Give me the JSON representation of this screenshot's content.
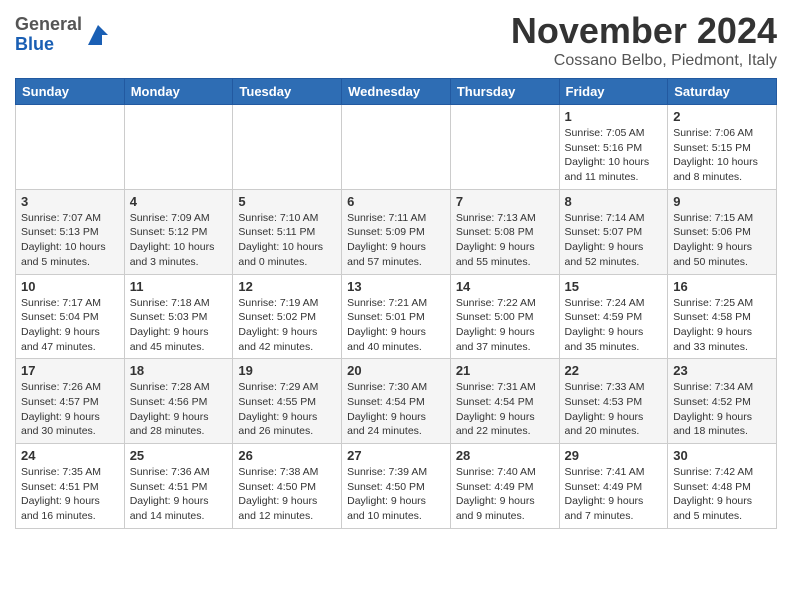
{
  "header": {
    "logo_general": "General",
    "logo_blue": "Blue",
    "month_title": "November 2024",
    "location": "Cossano Belbo, Piedmont, Italy"
  },
  "weekdays": [
    "Sunday",
    "Monday",
    "Tuesday",
    "Wednesday",
    "Thursday",
    "Friday",
    "Saturday"
  ],
  "weeks": [
    [
      {
        "day": "",
        "info": ""
      },
      {
        "day": "",
        "info": ""
      },
      {
        "day": "",
        "info": ""
      },
      {
        "day": "",
        "info": ""
      },
      {
        "day": "",
        "info": ""
      },
      {
        "day": "1",
        "info": "Sunrise: 7:05 AM\nSunset: 5:16 PM\nDaylight: 10 hours and 11 minutes."
      },
      {
        "day": "2",
        "info": "Sunrise: 7:06 AM\nSunset: 5:15 PM\nDaylight: 10 hours and 8 minutes."
      }
    ],
    [
      {
        "day": "3",
        "info": "Sunrise: 7:07 AM\nSunset: 5:13 PM\nDaylight: 10 hours and 5 minutes."
      },
      {
        "day": "4",
        "info": "Sunrise: 7:09 AM\nSunset: 5:12 PM\nDaylight: 10 hours and 3 minutes."
      },
      {
        "day": "5",
        "info": "Sunrise: 7:10 AM\nSunset: 5:11 PM\nDaylight: 10 hours and 0 minutes."
      },
      {
        "day": "6",
        "info": "Sunrise: 7:11 AM\nSunset: 5:09 PM\nDaylight: 9 hours and 57 minutes."
      },
      {
        "day": "7",
        "info": "Sunrise: 7:13 AM\nSunset: 5:08 PM\nDaylight: 9 hours and 55 minutes."
      },
      {
        "day": "8",
        "info": "Sunrise: 7:14 AM\nSunset: 5:07 PM\nDaylight: 9 hours and 52 minutes."
      },
      {
        "day": "9",
        "info": "Sunrise: 7:15 AM\nSunset: 5:06 PM\nDaylight: 9 hours and 50 minutes."
      }
    ],
    [
      {
        "day": "10",
        "info": "Sunrise: 7:17 AM\nSunset: 5:04 PM\nDaylight: 9 hours and 47 minutes."
      },
      {
        "day": "11",
        "info": "Sunrise: 7:18 AM\nSunset: 5:03 PM\nDaylight: 9 hours and 45 minutes."
      },
      {
        "day": "12",
        "info": "Sunrise: 7:19 AM\nSunset: 5:02 PM\nDaylight: 9 hours and 42 minutes."
      },
      {
        "day": "13",
        "info": "Sunrise: 7:21 AM\nSunset: 5:01 PM\nDaylight: 9 hours and 40 minutes."
      },
      {
        "day": "14",
        "info": "Sunrise: 7:22 AM\nSunset: 5:00 PM\nDaylight: 9 hours and 37 minutes."
      },
      {
        "day": "15",
        "info": "Sunrise: 7:24 AM\nSunset: 4:59 PM\nDaylight: 9 hours and 35 minutes."
      },
      {
        "day": "16",
        "info": "Sunrise: 7:25 AM\nSunset: 4:58 PM\nDaylight: 9 hours and 33 minutes."
      }
    ],
    [
      {
        "day": "17",
        "info": "Sunrise: 7:26 AM\nSunset: 4:57 PM\nDaylight: 9 hours and 30 minutes."
      },
      {
        "day": "18",
        "info": "Sunrise: 7:28 AM\nSunset: 4:56 PM\nDaylight: 9 hours and 28 minutes."
      },
      {
        "day": "19",
        "info": "Sunrise: 7:29 AM\nSunset: 4:55 PM\nDaylight: 9 hours and 26 minutes."
      },
      {
        "day": "20",
        "info": "Sunrise: 7:30 AM\nSunset: 4:54 PM\nDaylight: 9 hours and 24 minutes."
      },
      {
        "day": "21",
        "info": "Sunrise: 7:31 AM\nSunset: 4:54 PM\nDaylight: 9 hours and 22 minutes."
      },
      {
        "day": "22",
        "info": "Sunrise: 7:33 AM\nSunset: 4:53 PM\nDaylight: 9 hours and 20 minutes."
      },
      {
        "day": "23",
        "info": "Sunrise: 7:34 AM\nSunset: 4:52 PM\nDaylight: 9 hours and 18 minutes."
      }
    ],
    [
      {
        "day": "24",
        "info": "Sunrise: 7:35 AM\nSunset: 4:51 PM\nDaylight: 9 hours and 16 minutes."
      },
      {
        "day": "25",
        "info": "Sunrise: 7:36 AM\nSunset: 4:51 PM\nDaylight: 9 hours and 14 minutes."
      },
      {
        "day": "26",
        "info": "Sunrise: 7:38 AM\nSunset: 4:50 PM\nDaylight: 9 hours and 12 minutes."
      },
      {
        "day": "27",
        "info": "Sunrise: 7:39 AM\nSunset: 4:50 PM\nDaylight: 9 hours and 10 minutes."
      },
      {
        "day": "28",
        "info": "Sunrise: 7:40 AM\nSunset: 4:49 PM\nDaylight: 9 hours and 9 minutes."
      },
      {
        "day": "29",
        "info": "Sunrise: 7:41 AM\nSunset: 4:49 PM\nDaylight: 9 hours and 7 minutes."
      },
      {
        "day": "30",
        "info": "Sunrise: 7:42 AM\nSunset: 4:48 PM\nDaylight: 9 hours and 5 minutes."
      }
    ]
  ]
}
